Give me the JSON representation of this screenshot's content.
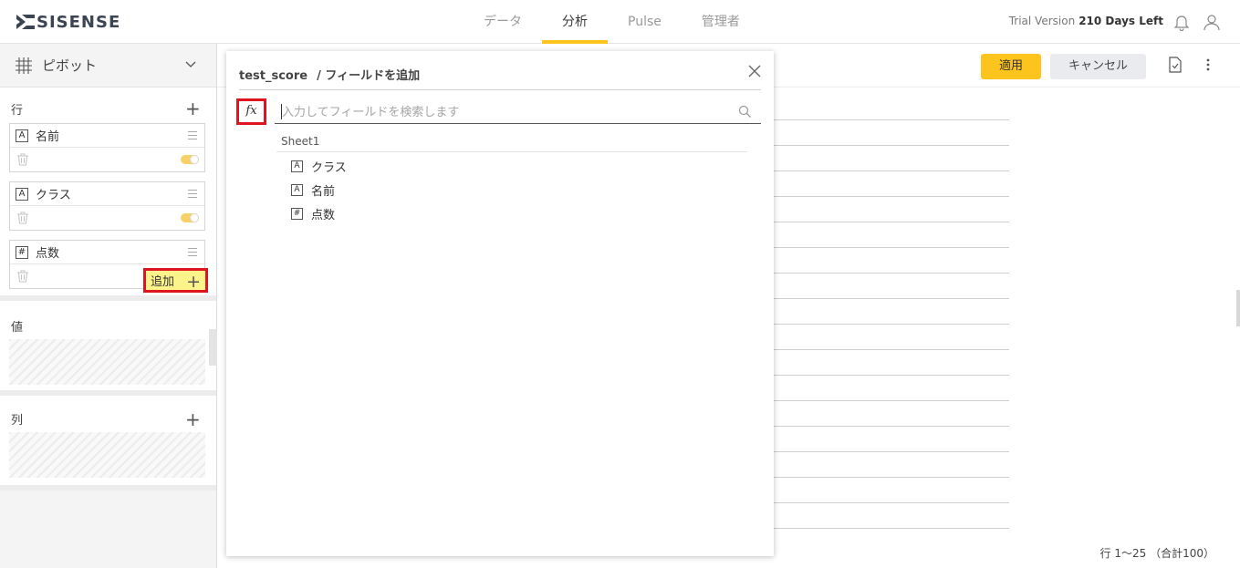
{
  "brand": {
    "name": "SISENSE"
  },
  "nav": {
    "tabs": [
      {
        "label": "データ"
      },
      {
        "label": "分析"
      },
      {
        "label": "Pulse"
      },
      {
        "label": "管理者"
      }
    ],
    "active_index": 1
  },
  "header": {
    "trial_label": "Trial Version",
    "days_left": "210 Days Left",
    "icons": [
      "bell-icon",
      "user-icon"
    ]
  },
  "left_panel": {
    "pivot_label": "ピボット",
    "rows_title": "行",
    "rows": [
      {
        "type_glyph": "A",
        "name": "名前"
      },
      {
        "type_glyph": "A",
        "name": "クラス"
      },
      {
        "type_glyph": "#",
        "name": "点数"
      }
    ],
    "values_title": "値",
    "values_add_label": "追加",
    "columns_title": "列"
  },
  "toolbar": {
    "apply_label": "適用",
    "cancel_label": "キャンセル"
  },
  "table_footer": {
    "row_info": "行 1〜25 （合計100）"
  },
  "dialog": {
    "datasource": "test_score",
    "title_suffix": "/ フィールドを追加",
    "fx_label": "fx",
    "search": {
      "placeholder": "入力してフィールドを検索します",
      "value": ""
    },
    "table_name": "Sheet1",
    "fields": [
      {
        "type_glyph": "A",
        "name": "クラス"
      },
      {
        "type_glyph": "A",
        "name": "名前"
      },
      {
        "type_glyph": "#",
        "name": "点数"
      }
    ]
  },
  "colors": {
    "accent": "#fcc41c",
    "highlight_border": "#e0141e",
    "highlight_fill": "#fcf38b",
    "toggle_on": "#f6d266"
  }
}
